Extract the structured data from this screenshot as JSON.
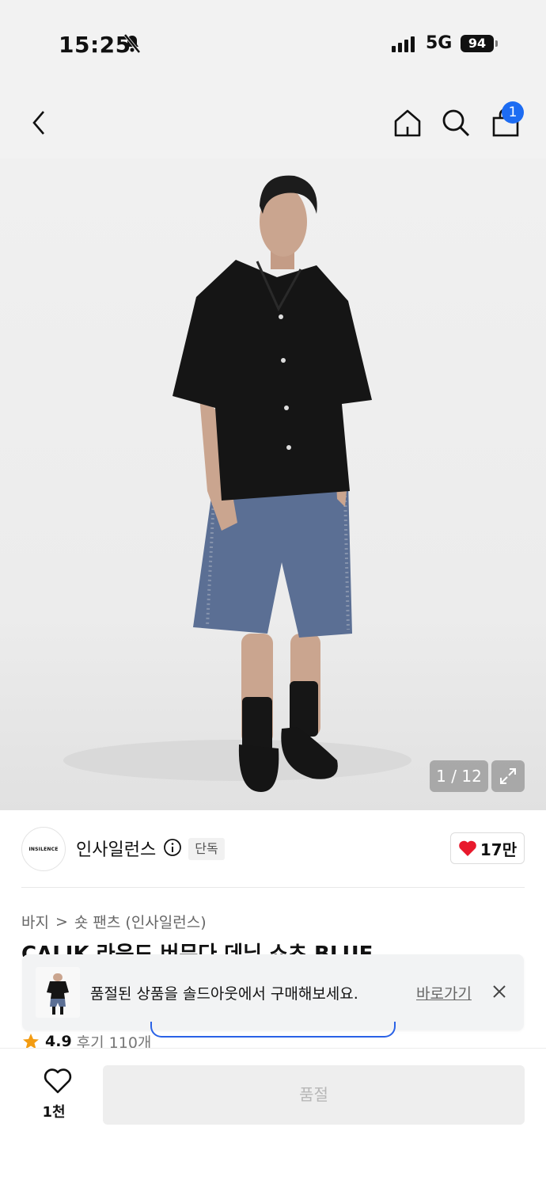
{
  "status_bar": {
    "time": "15:25",
    "network": "5G",
    "battery": "94"
  },
  "header": {
    "cart_count": "1"
  },
  "gallery": {
    "counter": "1 / 12"
  },
  "brand": {
    "logo_text": "INSILENCE",
    "name": "인사일런스",
    "exclusive_badge": "단독",
    "like_count": "17만"
  },
  "breadcrumb": {
    "category": "바지",
    "separator": ">",
    "subcategory": "숏 팬츠 (인사일런스)"
  },
  "product": {
    "title_partial": "CALIK 라운드 버뮤다 데님 쇼츠 BLUE"
  },
  "toast": {
    "message": "품절된 상품을 솔드아웃에서 구매해보세요.",
    "link": "바로가기"
  },
  "rating": {
    "score": "4.9",
    "reviews": "후기 110개"
  },
  "bottom_bar": {
    "wish_count": "1천",
    "soldout_label": "품절"
  },
  "colors": {
    "accent": "#1d6cf2",
    "heart": "#e8192c",
    "star": "#f39c12"
  }
}
